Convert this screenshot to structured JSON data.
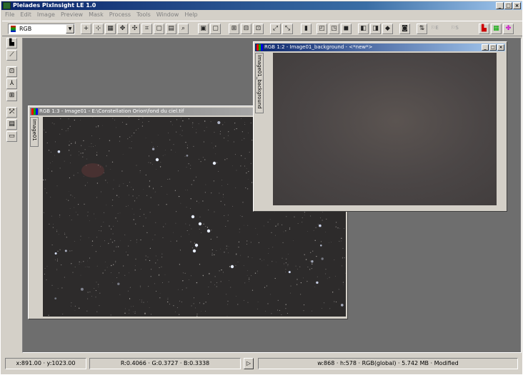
{
  "app": {
    "title": "Pleiades PixInsight LE 1.0"
  },
  "window_buttons": [
    "_",
    "□",
    "×"
  ],
  "menu": [
    "File",
    "Edit",
    "Image",
    "Preview",
    "Mask",
    "Process",
    "Tools",
    "Window",
    "Help"
  ],
  "toolbar": {
    "color_space": "RGB",
    "dropdown_arrow": "▼"
  },
  "windows": [
    {
      "title": "RGB 1:3 - Image01 - E:\\Constellation Orion\\fond du ciel.tif",
      "tab_label": "Image01",
      "icon": "rgb-image-icon"
    },
    {
      "title": "RGB 1:2 - Image01_background - <*new*>",
      "tab_label": "Image01_background",
      "icon": "rgb-image-icon"
    }
  ],
  "status": {
    "coords": "x:891.00 · y:1023.00",
    "values": "R:0.4066 · G:0.3727 · B:0.3338",
    "play": "▷",
    "info": "w:868 · h:578 · RGB(global) · 5.742 MB · Modified"
  },
  "colors": {
    "titlebar": "#0a246a",
    "workspace": "#6e6e6e",
    "chrome": "#d4d0c8"
  }
}
